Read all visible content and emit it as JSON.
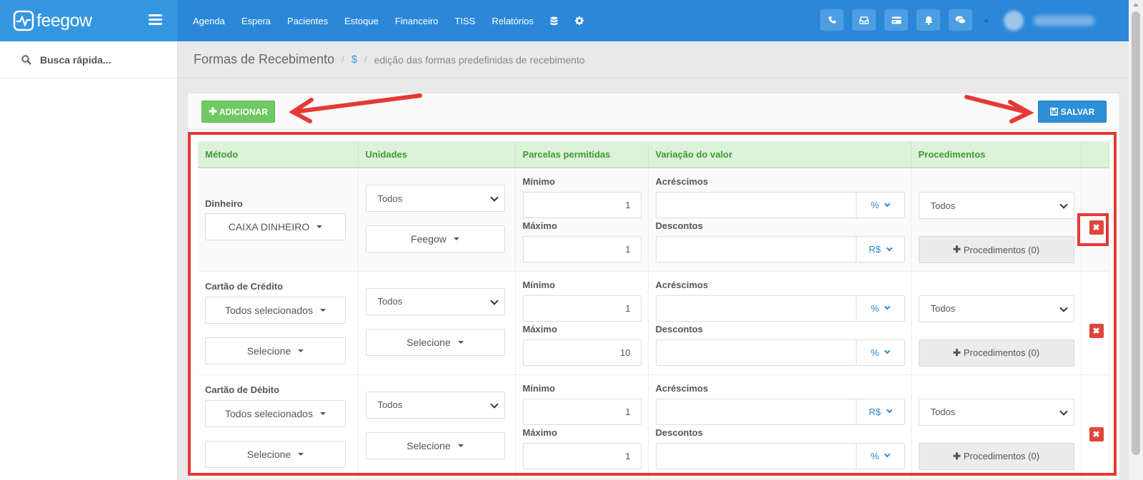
{
  "app": {
    "logo_text": "feegow"
  },
  "nav": {
    "items": [
      "Agenda",
      "Espera",
      "Pacientes",
      "Estoque",
      "Financeiro",
      "TISS",
      "Relatórios"
    ]
  },
  "sidebar": {
    "search_placeholder": "Busca rápida..."
  },
  "page": {
    "title": "Formas de Recebimento",
    "breadcrumb_icon": "$",
    "breadcrumb_desc": "edição das formas predefinidas de recebimento"
  },
  "toolbar": {
    "add_label": "ADICIONAR",
    "save_label": "SALVAR"
  },
  "table": {
    "headers": [
      "Método",
      "Unidades",
      "Parcelas permitidas",
      "Variação do valor",
      "Procedimentos",
      ""
    ],
    "rows": [
      {
        "method": "Dinheiro",
        "method_dropdowns": [
          "CAIXA DINHEIRO"
        ],
        "unit_select": "Todos",
        "unit_dropdown": "Feegow",
        "min_label": "Mínimo",
        "min_value": "1",
        "max_label": "Máximo",
        "max_value": "1",
        "add_label": "Acréscimos",
        "add_unit": "%",
        "disc_label": "Descontos",
        "disc_unit": "R$",
        "proc_select": "Todos",
        "proc_button": "Procedimentos (0)"
      },
      {
        "method": "Cartão de Crédito",
        "method_dropdowns": [
          "Todos selecionados",
          "Selecione"
        ],
        "unit_select": "Todos",
        "unit_dropdown": "Selecione",
        "min_label": "Mínimo",
        "min_value": "1",
        "max_label": "Máximo",
        "max_value": "10",
        "add_label": "Acréscimos",
        "add_unit": "%",
        "disc_label": "Descontos",
        "disc_unit": "%",
        "proc_select": "Todos",
        "proc_button": "Procedimentos (0)"
      },
      {
        "method": "Cartão de Débito",
        "method_dropdowns": [
          "Todos selecionados",
          "Selecione"
        ],
        "unit_select": "Todos",
        "unit_dropdown": "Selecione",
        "min_label": "Mínimo",
        "min_value": "1",
        "max_label": "Máximo",
        "max_value": "1",
        "add_label": "Acréscimos",
        "add_unit": "R$",
        "disc_label": "Descontos",
        "disc_unit": "%",
        "proc_select": "Todos",
        "proc_button": "Procedimentos (0)"
      }
    ]
  },
  "colors": {
    "topbar": "#2b88d9",
    "add_button": "#70ca63",
    "save_button": "#2d8fd8",
    "annotation": "#e53935",
    "header_green": "#3e9b30"
  }
}
